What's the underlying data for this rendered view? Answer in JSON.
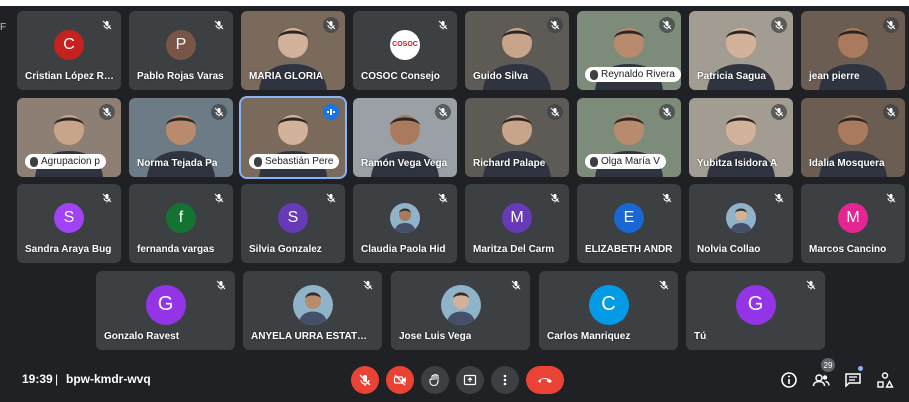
{
  "meeting": {
    "time": "19:39",
    "separator": "|",
    "code": "bpw-kmdr-wvq",
    "participant_count": "29"
  },
  "edge_letter": "F",
  "colors": {
    "bg": "#202124",
    "tile": "#3c4043",
    "red": "#ea4335",
    "blue": "#1a73e8"
  },
  "tiles": [
    {
      "name": "Cristian López Rivera",
      "letter": "C",
      "avatar": "#c5221f",
      "type": "avatar"
    },
    {
      "name": "Pablo Rojas Varas",
      "letter": "P",
      "avatar": "#795548",
      "type": "avatar"
    },
    {
      "name": "MARÍA GLORIA",
      "type": "video"
    },
    {
      "name": "COSOC Consejo",
      "type": "logo",
      "logo_text": "COSOC"
    },
    {
      "name": "Guido Silva",
      "type": "video"
    },
    {
      "name": "Reynaldo Rivera",
      "type": "video"
    },
    {
      "name": "Patricia Sagua",
      "type": "video"
    },
    {
      "name": "jean pierre",
      "type": "video"
    },
    {
      "name": "Agrupacion p",
      "type": "video"
    },
    {
      "name": "Norma Tejada Pa",
      "type": "video"
    },
    {
      "name": "Sebastián Pere",
      "type": "video"
    },
    {
      "name": "Ramón Vega Vega",
      "type": "video"
    },
    {
      "name": "Richard Palape",
      "type": "video"
    },
    {
      "name": "Olga María V",
      "type": "video"
    },
    {
      "name": "Yubitza Isidora A",
      "type": "video"
    },
    {
      "name": "Idalia Mosquera",
      "type": "video"
    },
    {
      "name": "Sandra Araya Bug",
      "letter": "S",
      "avatar": "#a142f4",
      "type": "avatar"
    },
    {
      "name": "fernanda vargas",
      "letter": "f",
      "avatar": "#137333",
      "type": "avatar"
    },
    {
      "name": "Silvia Gonzalez",
      "letter": "S",
      "avatar": "#673ab7",
      "type": "avatar"
    },
    {
      "name": "Claudia Paola Hid",
      "type": "photo"
    },
    {
      "name": "Maritza Del Carm",
      "letter": "M",
      "avatar": "#673ab7",
      "type": "avatar"
    },
    {
      "name": "ELIZABETH ANDR",
      "letter": "E",
      "avatar": "#1967d2",
      "type": "avatar"
    },
    {
      "name": "Nolvia Collao",
      "type": "photo"
    },
    {
      "name": "Marcos Cancino",
      "letter": "M",
      "avatar": "#e52592",
      "type": "avatar"
    },
    {
      "name": "Gonzalo Ravest",
      "letter": "G",
      "avatar": "#9334e6",
      "type": "avatar"
    },
    {
      "name": "ANYELA URRA ESTATOPU",
      "type": "photo"
    },
    {
      "name": "Jose Luis Vega",
      "type": "photo"
    },
    {
      "name": "Carlos Manriquez",
      "letter": "C",
      "avatar": "#039be5",
      "type": "avatar"
    },
    {
      "name": "Tú",
      "letter": "G",
      "avatar": "#9334e6",
      "type": "avatar"
    }
  ],
  "controls": [
    "mic-off",
    "camera-off",
    "raise-hand",
    "present",
    "more-options",
    "leave-call"
  ],
  "right_controls": [
    "info",
    "people",
    "chat",
    "activities"
  ]
}
